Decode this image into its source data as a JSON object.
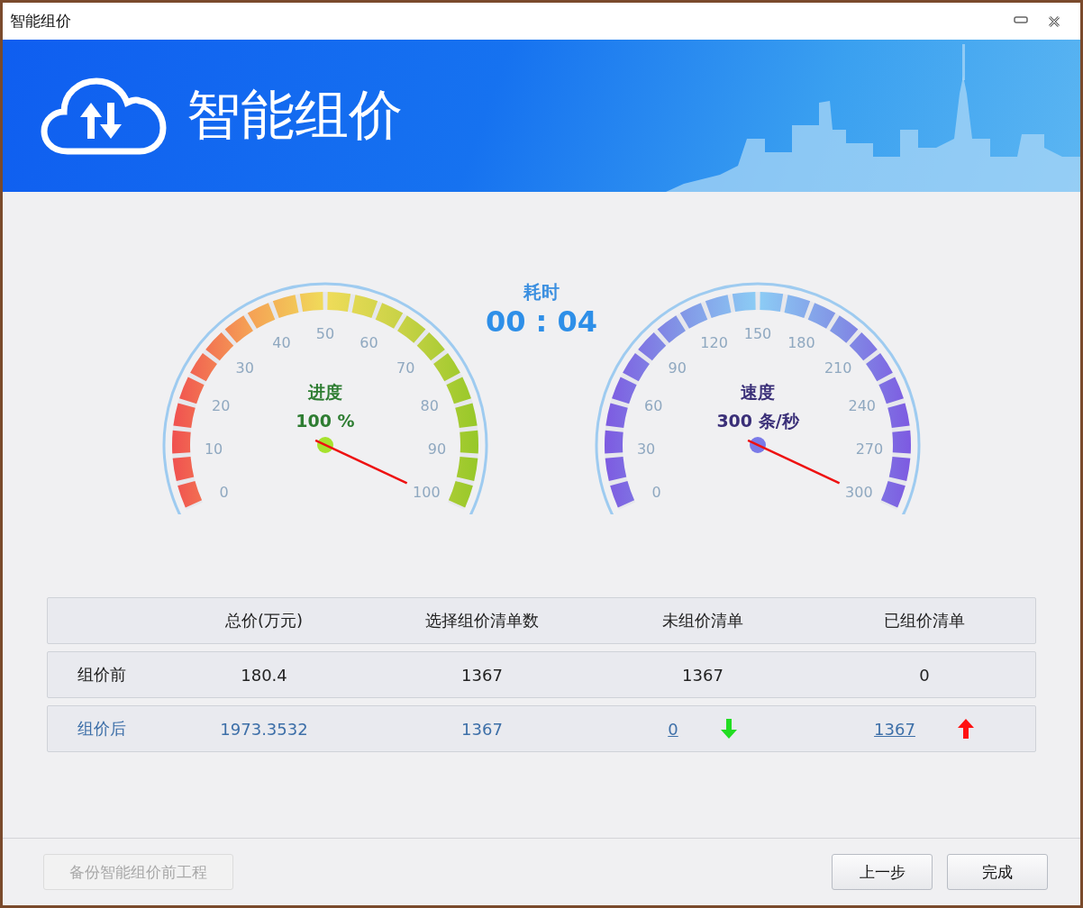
{
  "window": {
    "title": "智能组价"
  },
  "banner": {
    "title": "智能组价"
  },
  "elapsed": {
    "label": "耗时",
    "value": "00 : 04"
  },
  "gauges": [
    {
      "kind": "progress",
      "label": "进度",
      "reading": "100 %",
      "level": 1,
      "ticks": [
        "0",
        "10",
        "20",
        "30",
        "40",
        "50",
        "60",
        "70",
        "80",
        "90",
        "100"
      ]
    },
    {
      "kind": "speed",
      "label": "速度",
      "reading": "300 条/秒",
      "level": 1,
      "ticks": [
        "0",
        "30",
        "60",
        "90",
        "120",
        "150",
        "180",
        "210",
        "240",
        "270",
        "300"
      ]
    }
  ],
  "table": {
    "columns": [
      "总价(万元)",
      "选择组价清单数",
      "未组价清单",
      "已组价清单"
    ],
    "rows": [
      {
        "kind": "before",
        "label": "组价前",
        "cells": [
          {
            "text": "180.4"
          },
          {
            "text": "1367"
          },
          {
            "text": "1367"
          },
          {
            "text": "0"
          }
        ]
      },
      {
        "kind": "after",
        "label": "组价后",
        "cells": [
          {
            "text": "1973.3532"
          },
          {
            "text": "1367"
          },
          {
            "text": "0",
            "link": true,
            "kind": "down"
          },
          {
            "text": "1367",
            "link": true,
            "kind": "up"
          }
        ]
      }
    ]
  },
  "buttons": [
    {
      "label": "备份智能组价前工程",
      "disabled": true
    },
    {
      "label": "上一步",
      "disabled": false
    },
    {
      "label": "完成",
      "disabled": false
    }
  ]
}
